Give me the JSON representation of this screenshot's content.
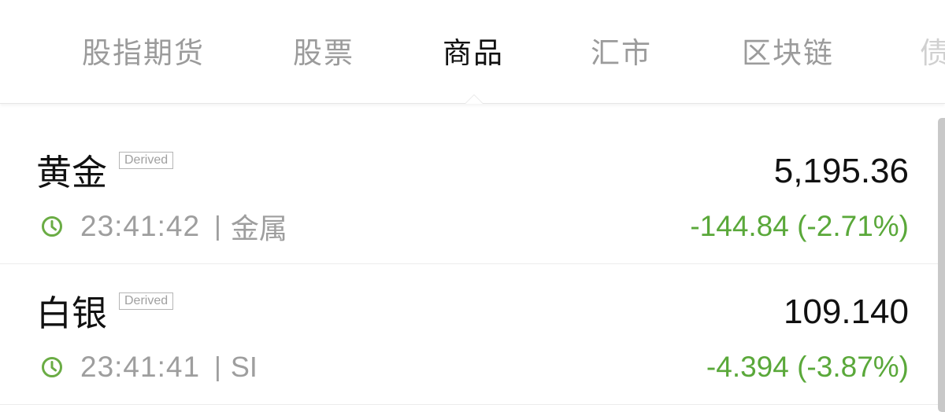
{
  "tabs": [
    {
      "label": "股指期货",
      "active": false
    },
    {
      "label": "股票",
      "active": false
    },
    {
      "label": "商品",
      "active": true
    },
    {
      "label": "汇市",
      "active": false
    },
    {
      "label": "区块链",
      "active": false
    },
    {
      "label": "债",
      "active": false
    }
  ],
  "quotes": [
    {
      "name": "黄金",
      "tag": "Derived",
      "price": "5,195.36",
      "time": "23:41:42",
      "separator": "|",
      "category": "金属",
      "change": "-144.84 (-2.71%)",
      "clock_icon": "clock-icon"
    },
    {
      "name": "白银",
      "tag": "Derived",
      "price": "109.140",
      "time": "23:41:41",
      "separator": "|",
      "category": "SI",
      "change": "-4.394 (-3.87%)",
      "clock_icon": "clock-icon"
    }
  ],
  "colors": {
    "change_down": "#5aa83a",
    "active_tab": "#111111",
    "inactive_tab": "#9b9b9b",
    "clock_icon": "#6aac44"
  }
}
